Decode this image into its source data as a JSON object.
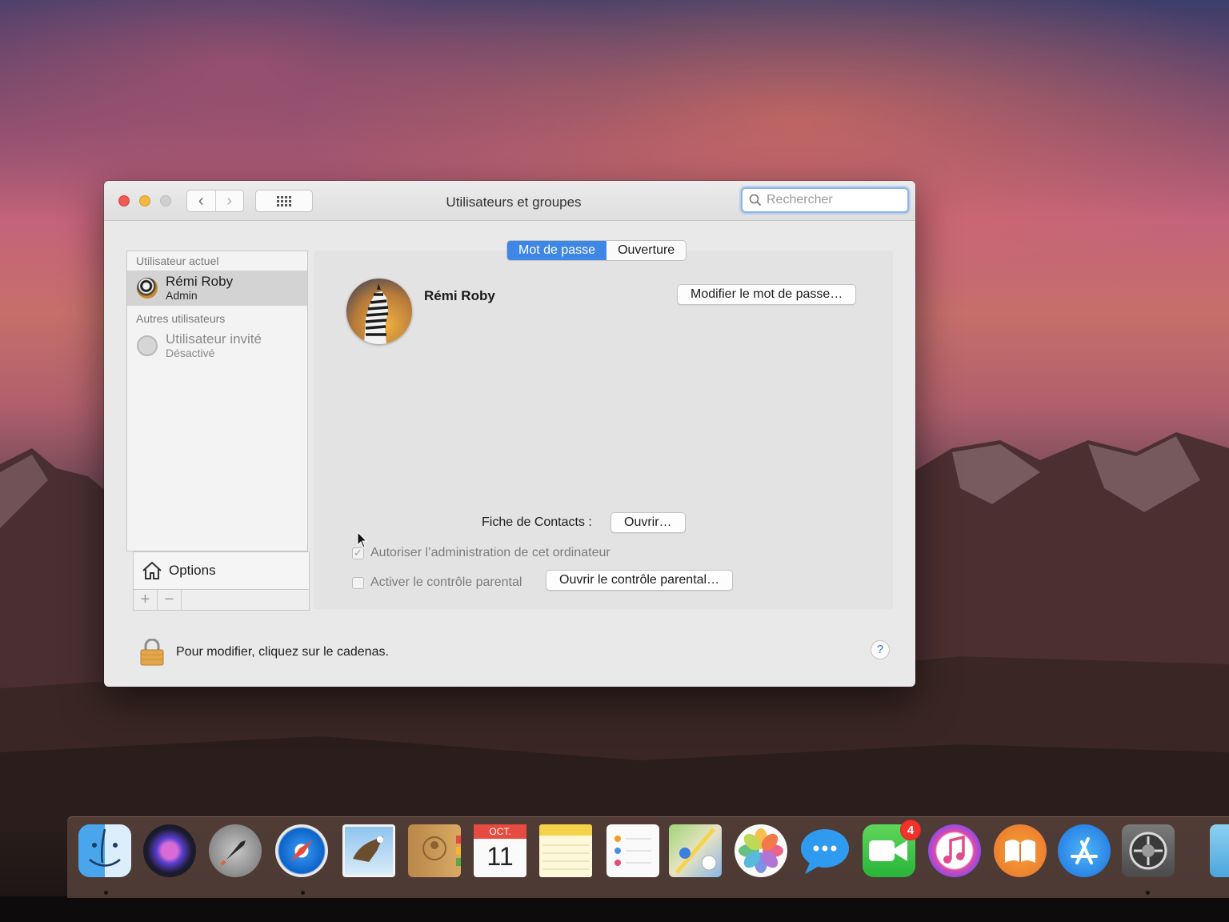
{
  "window": {
    "title": "Utilisateurs et groupes",
    "search_placeholder": "Rechercher"
  },
  "sidebar": {
    "current_header": "Utilisateur actuel",
    "current_user": {
      "name": "Rémi Roby",
      "role": "Admin"
    },
    "others_header": "Autres utilisateurs",
    "other_users": [
      {
        "name": "Utilisateur invité",
        "role": "Désactivé"
      }
    ],
    "options_label": "Options",
    "add_label": "+",
    "remove_label": "−"
  },
  "tabs": {
    "items": [
      "Mot de passe",
      "Ouverture"
    ],
    "selected": "Mot de passe"
  },
  "profile": {
    "name": "Rémi Roby",
    "change_password_button": "Modifier le mot de passe…",
    "contacts_label": "Fiche de Contacts :",
    "contacts_button": "Ouvrir…",
    "admin_checkbox_label": "Autoriser l’administration de cet ordinateur",
    "admin_checked": true,
    "parental_checkbox_label": "Activer le contrôle parental",
    "parental_checked": false,
    "parental_button": "Ouvrir le contrôle parental…"
  },
  "footer": {
    "lock_text": "Pour modifier, cliquez sur le cadenas.",
    "help_label": "?"
  },
  "dock": {
    "icons": [
      "finder-icon",
      "siri-icon",
      "launchpad-icon",
      "safari-icon",
      "mail-icon",
      "contacts-icon",
      "calendar-icon",
      "notes-icon",
      "reminders-icon",
      "maps-icon",
      "photos-icon",
      "messages-icon",
      "facetime-icon",
      "itunes-icon",
      "ibooks-icon",
      "app-store-icon",
      "system-preferences-icon"
    ],
    "calendar_month": "OCT.",
    "calendar_day": "11",
    "facetime_badge": "4"
  },
  "colors": {
    "accent": "#3f87e6",
    "close": "#ee5b55",
    "minimize": "#f3b83e",
    "badge": "#f2322b"
  }
}
